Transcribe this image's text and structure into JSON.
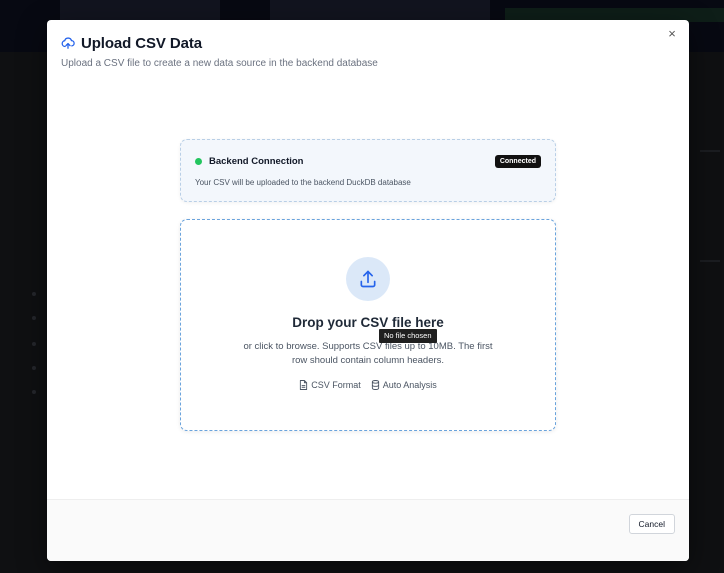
{
  "dialog": {
    "title": "Upload CSV Data",
    "subtitle": "Upload a CSV file to create a new data source in the backend database",
    "close_icon": "×",
    "title_icon": "cloud-upload-icon"
  },
  "connection": {
    "title": "Backend Connection",
    "badge": "Connected",
    "status_color": "#22c55e",
    "description": "Your CSV will be uploaded to the backend DuckDB database"
  },
  "dropzone": {
    "icon": "upload-icon",
    "title": "Drop your CSV file here",
    "description": "or click to browse. Supports CSV files up to 10MB. The first row should contain column headers.",
    "tooltip": "No file chosen",
    "features": [
      {
        "icon": "file-text-icon",
        "label": "CSV Format"
      },
      {
        "icon": "database-icon",
        "label": "Auto Analysis"
      }
    ]
  },
  "footer": {
    "cancel_label": "Cancel"
  },
  "colors": {
    "accent": "#2563eb",
    "dropzone_border": "#6aa3dc",
    "badge_bg": "#111111"
  }
}
